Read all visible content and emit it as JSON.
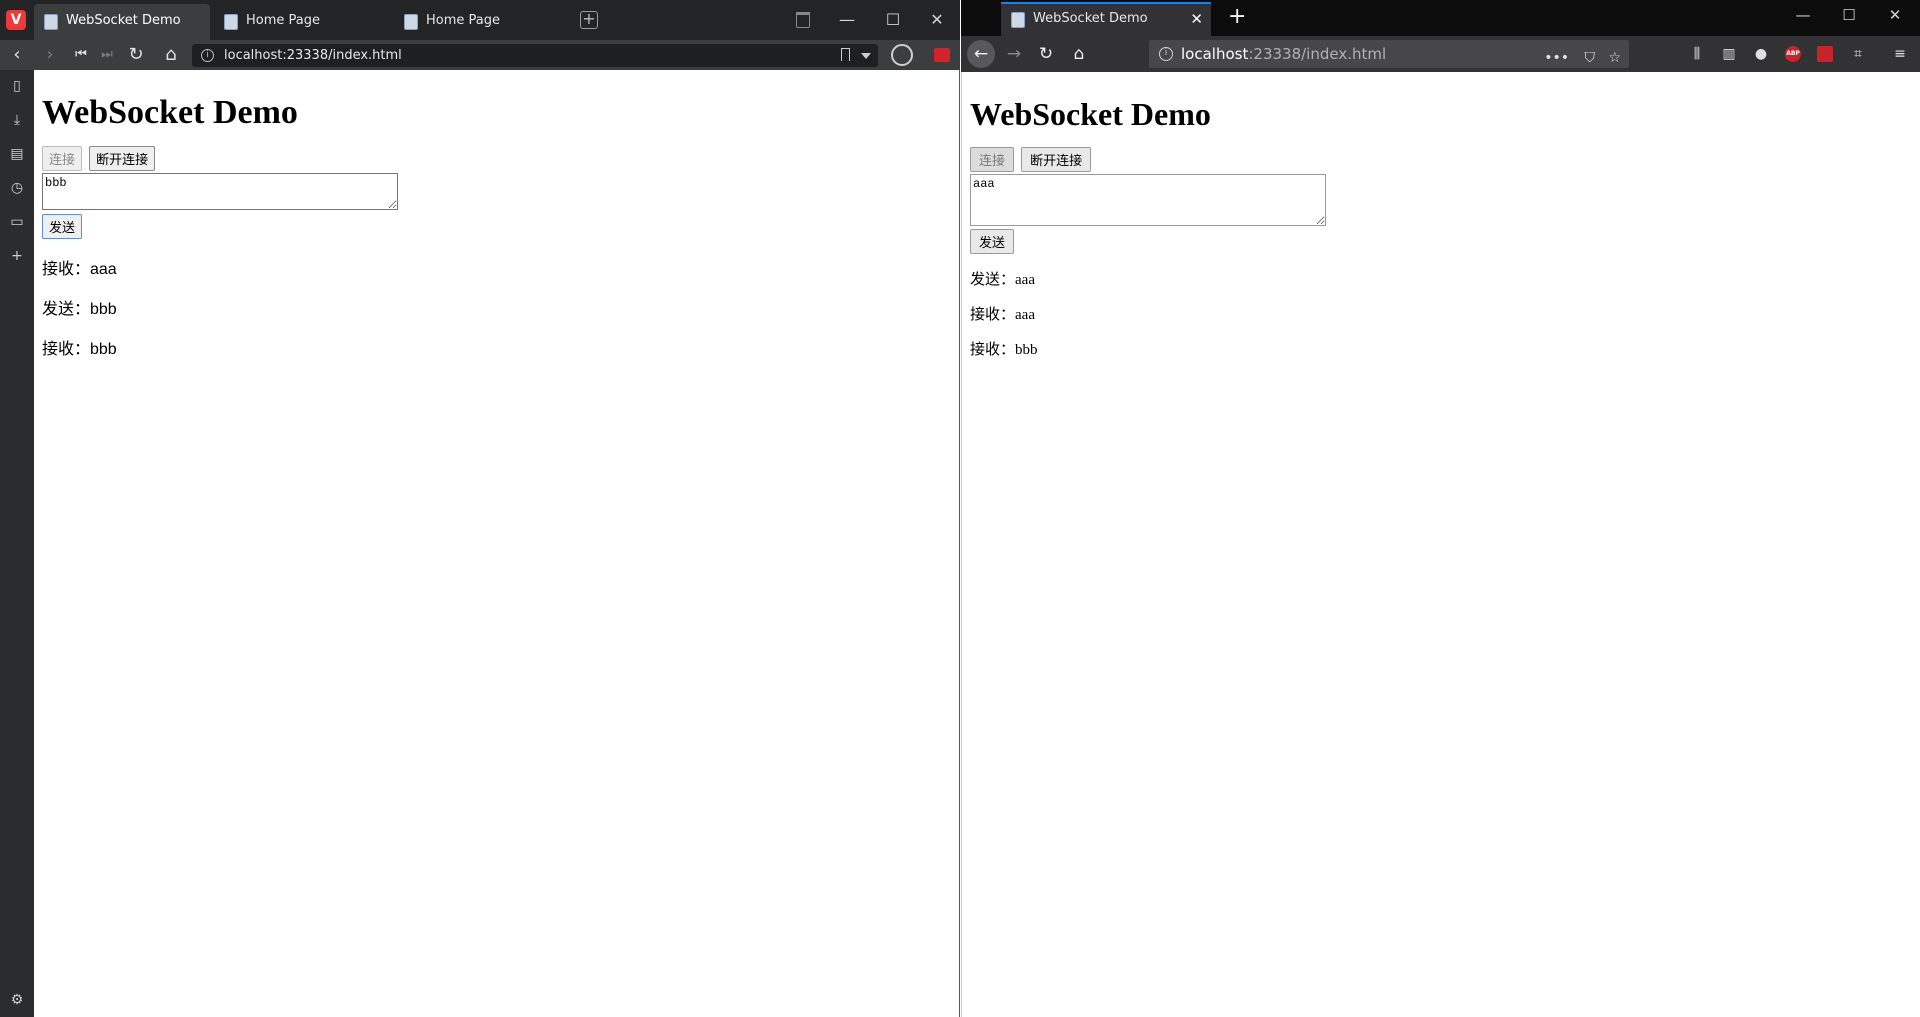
{
  "left_browser": {
    "logo": "V",
    "tabs": [
      {
        "label": "WebSocket Demo",
        "active": true
      },
      {
        "label": "Home Page",
        "active": false
      },
      {
        "label": "Home Page",
        "active": false
      }
    ],
    "url": "localhost:23338/index.html",
    "window_controls": {
      "minimize": "—",
      "maximize": "☐",
      "close": "✕"
    }
  },
  "right_browser": {
    "tabs": [
      {
        "label": "WebSocket Demo",
        "active": true
      }
    ],
    "url_host": "localhost",
    "url_rest": ":23338/index.html",
    "window_controls": {
      "minimize": "—",
      "maximize": "☐",
      "close": "✕"
    },
    "extension_labels": {
      "abp": "ABP"
    }
  },
  "page_left": {
    "title": "WebSocket Demo",
    "connect_label": "连接",
    "disconnect_label": "断开连接",
    "textarea_value": "bbb",
    "send_label": "发送",
    "messages": [
      "接收：aaa",
      "发送：bbb",
      "接收：bbb"
    ]
  },
  "page_right": {
    "title": "WebSocket Demo",
    "connect_label": "连接",
    "disconnect_label": "断开连接",
    "textarea_value": "aaa",
    "send_label": "发送",
    "messages": [
      "发送：aaa",
      "接收：aaa",
      "接收：bbb"
    ]
  },
  "colors": {
    "firefox_accent": "#0a84ff",
    "vivaldi_red": "#ef3939"
  }
}
